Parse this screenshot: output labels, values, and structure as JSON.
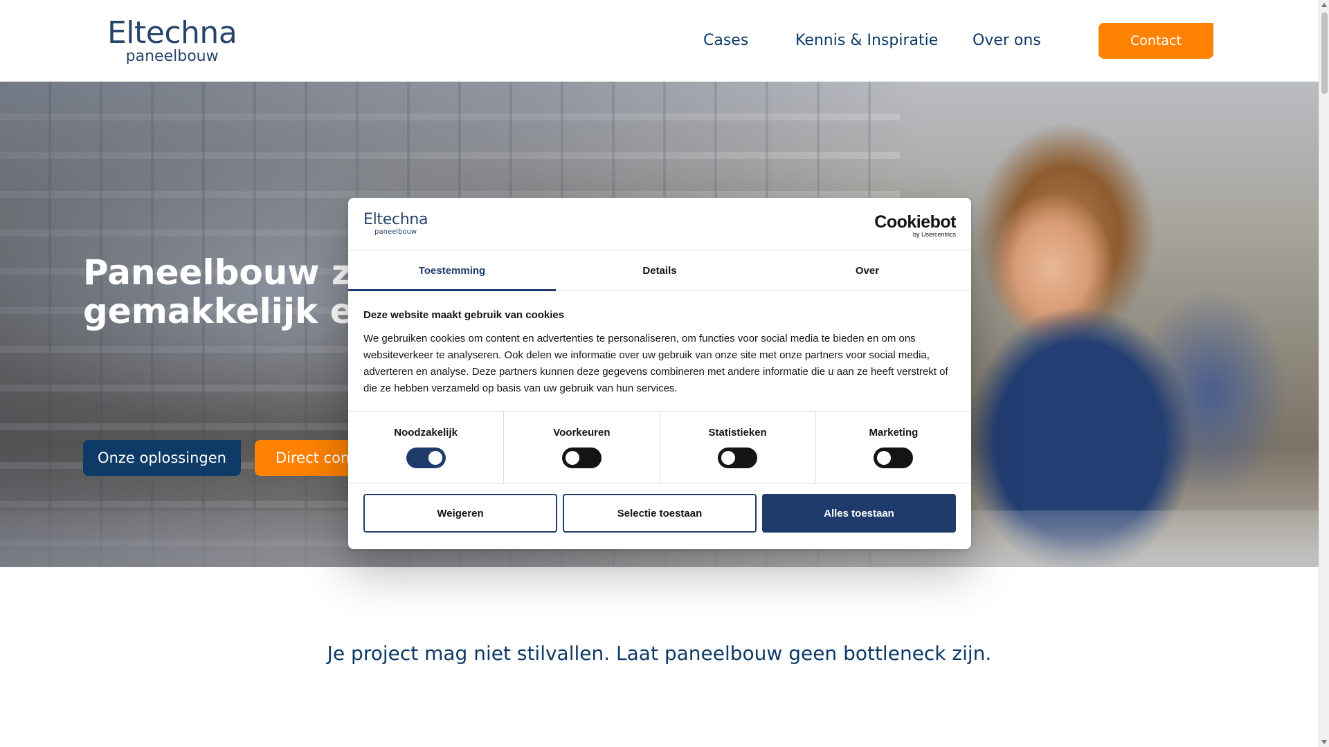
{
  "header": {
    "logo_main": "Eltechna",
    "logo_sub": "paneelbouw",
    "nav": [
      "Cases",
      "Kennis & Inspiratie",
      "Over ons"
    ],
    "contact_label": "Contact"
  },
  "hero": {
    "title_line1": "Paneelbouw zon",
    "title_line2": "gemakkelijk en o",
    "primary_button": "Onze oplossingen",
    "secondary_button": "Direct cont"
  },
  "tagline": "Je project mag niet stilvallen. Laat paneelbouw geen bottleneck zijn.",
  "cookie_dialog": {
    "logo_main": "Eltechna",
    "logo_sub": "paneelbouw",
    "provider_main": "Cookiebot",
    "provider_sub": "by Usercentrics",
    "tabs": [
      "Toestemming",
      "Details",
      "Over"
    ],
    "active_tab": "Toestemming",
    "heading": "Deze website maakt gebruik van cookies",
    "body": "We gebruiken cookies om content en advertenties te personaliseren, om functies voor social media te bieden en om ons websiteverkeer te analyseren. Ook delen we informatie over uw gebruik van onze site met onze partners voor social media, adverteren en analyse. Deze partners kunnen deze gegevens combineren met andere informatie die u aan ze heeft verstrekt of die ze hebben verzameld op basis van uw gebruik van hun services.",
    "categories": [
      {
        "label": "Noodzakelijk",
        "enabled": true
      },
      {
        "label": "Voorkeuren",
        "enabled": false
      },
      {
        "label": "Statistieken",
        "enabled": false
      },
      {
        "label": "Marketing",
        "enabled": false
      }
    ],
    "buttons": {
      "deny": "Weigeren",
      "allow_selection": "Selectie toestaan",
      "allow_all": "Alles toestaan"
    }
  },
  "colors": {
    "brand_navy": "#0d3a66",
    "brand_orange": "#ff8202",
    "dialog_accent": "#1f3b6b"
  }
}
